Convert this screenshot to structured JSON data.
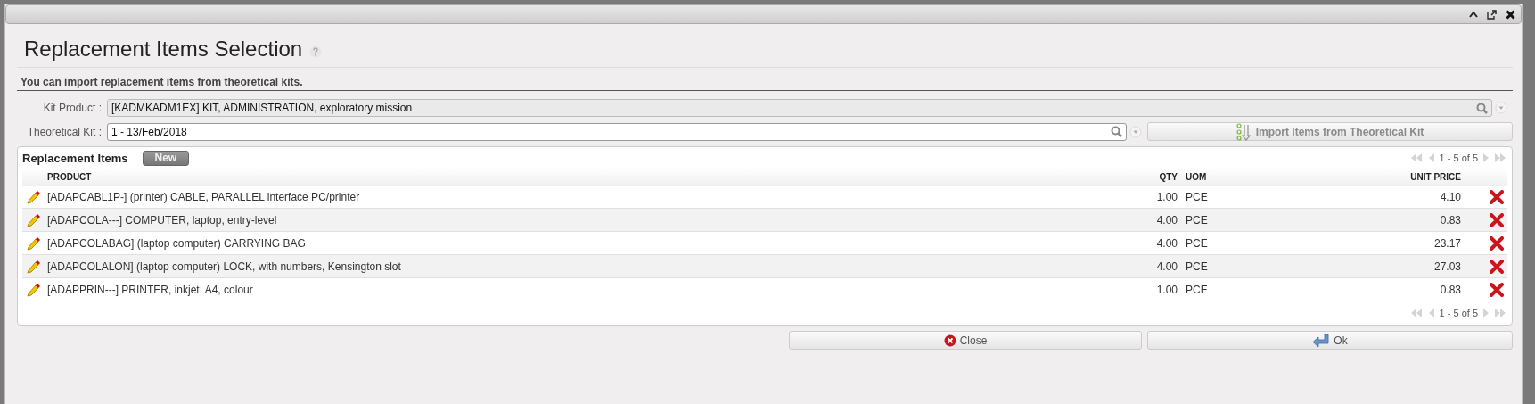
{
  "dialog": {
    "title": "Replacement Items Selection",
    "subtitle": "You can import replacement items from theoretical kits."
  },
  "fields": [
    {
      "label": "Kit Product :",
      "value": "[KADMKADM1EX] KIT, ADMINISTRATION, exploratory mission",
      "disabled": true
    },
    {
      "label": "Theoretical Kit :",
      "value": "1 - 13/Feb/2018",
      "disabled": false
    }
  ],
  "import_button": {
    "label": "Import Items from Theoretical Kit",
    "disabled": true
  },
  "panel": {
    "title": "Replacement Items",
    "new_button": "New",
    "pager_top": "1 - 5 of 5",
    "pager_bottom": "1 - 5 of 5"
  },
  "table": {
    "columns": [
      "PRODUCT",
      "QTY",
      "UOM",
      "UNIT PRICE"
    ],
    "rows": [
      {
        "product": "[ADAPCABL1P-] (printer) CABLE, PARALLEL interface PC/printer",
        "qty": "1.00",
        "uom": "PCE",
        "unit_price": "4.10"
      },
      {
        "product": "[ADAPCOLA---] COMPUTER, laptop, entry-level",
        "qty": "4.00",
        "uom": "PCE",
        "unit_price": "0.83"
      },
      {
        "product": "[ADAPCOLABAG] (laptop computer) CARRYING BAG",
        "qty": "4.00",
        "uom": "PCE",
        "unit_price": "23.17"
      },
      {
        "product": "[ADAPCOLALON] (laptop computer) LOCK, with numbers, Kensington slot",
        "qty": "4.00",
        "uom": "PCE",
        "unit_price": "27.03"
      },
      {
        "product": "[ADAPPRIN---] PRINTER, inkjet, A4, colour",
        "qty": "1.00",
        "uom": "PCE",
        "unit_price": "0.83"
      }
    ]
  },
  "buttons": [
    {
      "kind": "close",
      "label": "Close"
    },
    {
      "kind": "ok",
      "label": "Ok"
    }
  ]
}
